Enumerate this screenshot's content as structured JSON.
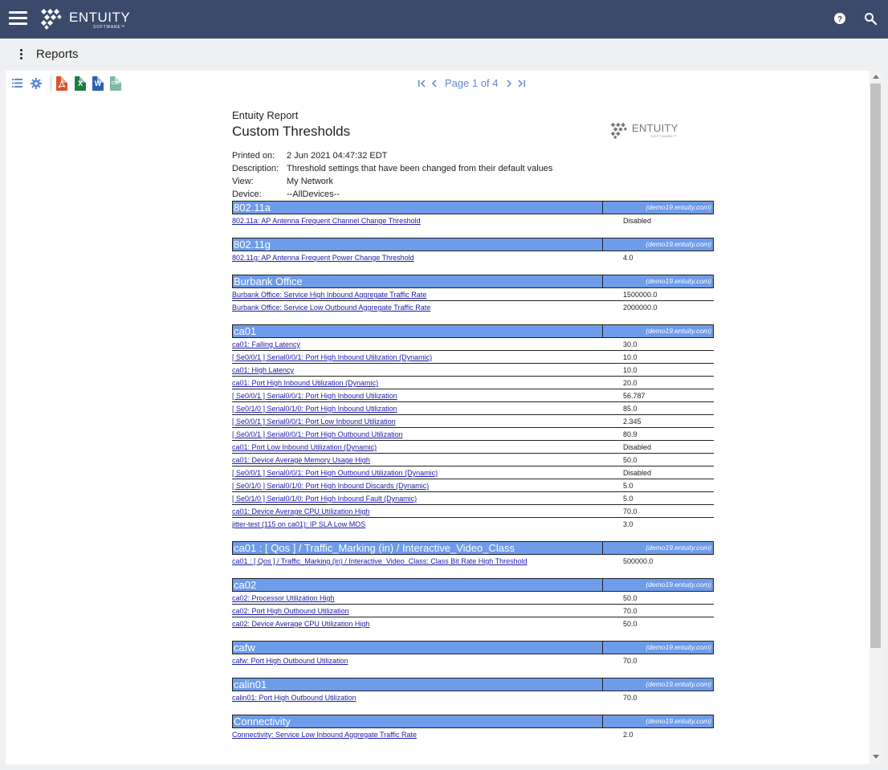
{
  "app": {
    "logo_word": "ENTUITY",
    "logo_sub": "SOFTWARE™",
    "icons": [
      "menu-icon",
      "help-icon",
      "search-icon"
    ]
  },
  "header": {
    "title": "Reports"
  },
  "toolbar": {
    "icons": [
      "list-icon",
      "gear-icon",
      "pdf-file-icon",
      "excel-file-icon",
      "word-file-icon",
      "csv-file-icon"
    ],
    "file_letters": {
      "excel": "X",
      "word": "W",
      "csv": "CSV"
    },
    "colors": {
      "pdf": "#d9532b",
      "excel": "#1f7a45",
      "word": "#2b5fb4",
      "csv": "#7fb7a0",
      "accent": "#5b87d6",
      "section": "#6e9bea",
      "topbar": "#3a4a6b"
    }
  },
  "pager": {
    "label": "Page 1 of 4",
    "current": 1,
    "total": 4
  },
  "report": {
    "brand": "Entuity Report",
    "title": "Custom Thresholds",
    "logo_word": "ENTUITY",
    "logo_sub": "SOFTWARE™",
    "meta": [
      {
        "key": "Printed on:",
        "value": "2 Jun 2021 04:47:32 EDT"
      },
      {
        "key": "Description:",
        "value": "Threshold settings that have been changed from their default values"
      },
      {
        "key": "View:",
        "value": "My Network"
      },
      {
        "key": "Device:",
        "value": "--AllDevices--"
      }
    ],
    "sections": [
      {
        "name": "802.11a",
        "host": "(demo19.entuity.com)",
        "rows": [
          {
            "name": "802.11a: AP Antenna Frequent Channel Change Threshold",
            "value": "Disabled"
          }
        ]
      },
      {
        "name": "802.11g",
        "host": "(demo19.entuity.com)",
        "rows": [
          {
            "name": "802.11g: AP Antenna Frequent Power Change Threshold",
            "value": "4.0"
          }
        ]
      },
      {
        "name": "Burbank Office",
        "host": "(demo19.entuity.com)",
        "rows": [
          {
            "name": "Burbank Office: Service High Inbound Aggregate Traffic Rate",
            "value": "1500000.0"
          },
          {
            "name": "Burbank Office: Service Low Outbound Aggregate Traffic Rate",
            "value": "2000000.0"
          }
        ]
      },
      {
        "name": "ca01",
        "host": "(demo19.entuity.com)",
        "rows": [
          {
            "name": "ca01: Falling Latency",
            "value": "30.0"
          },
          {
            "name": "[ Se0/0/1 ] Serial0/0/1: Port High Inbound Utilization (Dynamic)",
            "value": "10.0"
          },
          {
            "name": "ca01: High Latency",
            "value": "10.0"
          },
          {
            "name": "ca01: Port High Inbound Utilization (Dynamic)",
            "value": "20.0"
          },
          {
            "name": "[ Se0/0/1 ] Serial0/0/1: Port High Inbound Utilization",
            "value": "56.787"
          },
          {
            "name": "[ Se0/1/0 ] Serial0/1/0: Port High Inbound Utilization",
            "value": "85.0"
          },
          {
            "name": "[ Se0/0/1 ] Serial0/0/1: Port Low Inbound Utilization",
            "value": "2.345"
          },
          {
            "name": "[ Se0/0/1 ] Serial0/0/1: Port High Outbound Utilization",
            "value": "80.9"
          },
          {
            "name": "ca01: Port Low Inbound Utilization (Dynamic)",
            "value": "Disabled"
          },
          {
            "name": "ca01: Device Average Memory Usage High",
            "value": "50.0"
          },
          {
            "name": "[ Se0/0/1 ] Serial0/0/1: Port High Outbound Utilization (Dynamic)",
            "value": "Disabled"
          },
          {
            "name": "[ Se0/1/0 ] Serial0/1/0: Port High Inbound Discards (Dynamic)",
            "value": "5.0"
          },
          {
            "name": "[ Se0/1/0 ] Serial0/1/0: Port High Inbound Fault (Dynamic)",
            "value": "5.0"
          },
          {
            "name": "ca01: Device Average CPU Utilization High",
            "value": "70.0"
          },
          {
            "name": "jitter-test (115 on ca01): IP SLA Low MOS",
            "value": "3.0"
          }
        ]
      },
      {
        "name": "ca01 : [ Qos ] / Traffic_Marking (in) / Interactive_Video_Class",
        "host": "(demo19.entuity.com)",
        "rows": [
          {
            "name": "ca01 : [ Qos ] / Traffic_Marking (in) / Interactive_Video_Class: Class Bit Rate High Threshold",
            "value": "500000.0"
          }
        ]
      },
      {
        "name": "ca02",
        "host": "(demo19.entuity.com)",
        "rows": [
          {
            "name": "ca02: Processor Utilization High",
            "value": "50.0"
          },
          {
            "name": "ca02: Port High Outbound Utilization",
            "value": "70.0"
          },
          {
            "name": "ca02: Device Average CPU Utilization High",
            "value": "50.0"
          }
        ]
      },
      {
        "name": "cafw",
        "host": "(demo19.entuity.com)",
        "rows": [
          {
            "name": "cafw: Port High Outbound Utilization",
            "value": "70.0"
          }
        ]
      },
      {
        "name": "calin01",
        "host": "(demo19.entuity.com)",
        "rows": [
          {
            "name": "calin01: Port High Outbound Utilization",
            "value": "70.0"
          }
        ]
      },
      {
        "name": "Connectivity",
        "host": "(demo19.entuity.com)",
        "rows": [
          {
            "name": "Connectivity: Service Low Inbound Aggregate Traffic Rate",
            "value": "2.0"
          }
        ]
      }
    ]
  }
}
